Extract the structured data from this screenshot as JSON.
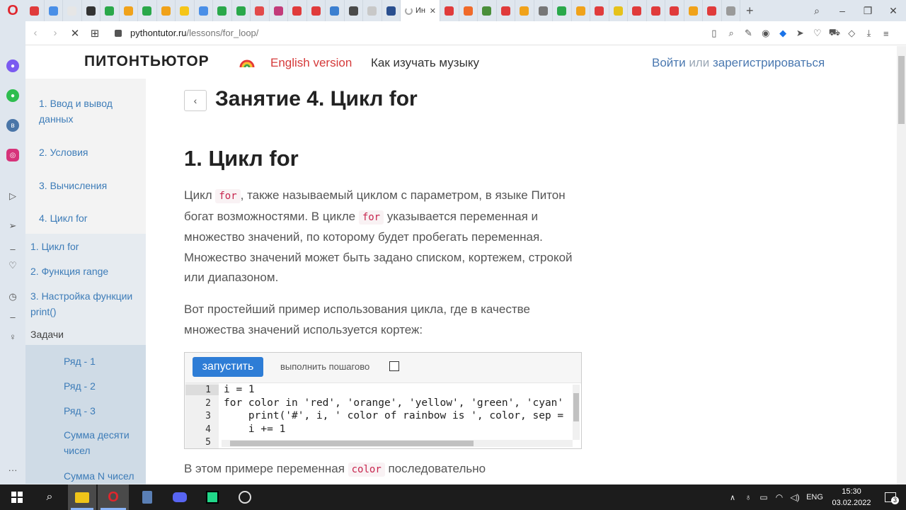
{
  "browser": {
    "active_tab_label": "Ин",
    "url_host": "pythontutor.ru",
    "url_path": "/lessons/for_loop/",
    "tab_favicon_colors": [
      "#e03b3b",
      "#4a8fe7",
      "#e6e6e6",
      "#333333",
      "#2aa84a",
      "#f0a21a",
      "#2aa84a",
      "#f0a21a",
      "#f5c518",
      "#4a8fe7",
      "#2aa84a",
      "#2aa84a",
      "#e24a4a",
      "#c23b7a",
      "#e03b3b",
      "#e03b3b",
      "#3b7fd0",
      "#4a4a4a",
      "#c8c8c8",
      "#2a4f8f",
      "#e03b3b",
      "#f06a2a",
      "#4a8f3a",
      "#e03b3b",
      "#f0a21a",
      "#777777",
      "#2aa84a",
      "#f0a21a",
      "#e03b3b",
      "#e6c21a",
      "#e03b3b",
      "#e03b3b",
      "#e03b3b",
      "#f0a21a",
      "#e03b3b",
      "#9a9a9a"
    ]
  },
  "site": {
    "logo": "ПИТОНТЬЮТОР",
    "english_link": "English version",
    "music_link": "Как изучать музыку",
    "login": "Войти",
    "or": "или",
    "register": "зарегистрироваться"
  },
  "nav": {
    "items": [
      {
        "label": "1. Ввод и вывод данных"
      },
      {
        "label": "2. Условия"
      },
      {
        "label": "3. Вычисления"
      },
      {
        "label": "4. Цикл for"
      }
    ],
    "sub": [
      {
        "label": "1. Цикл for"
      },
      {
        "label": "2. Функция range"
      },
      {
        "label": "3. Настройка функции print()"
      }
    ],
    "tasks_label": "Задачи",
    "tasks": [
      {
        "label": "Ряд - 1"
      },
      {
        "label": "Ряд - 2"
      },
      {
        "label": "Ряд - 3"
      },
      {
        "label": "Сумма десяти чисел"
      },
      {
        "label": "Сумма N чисел"
      }
    ]
  },
  "content": {
    "lesson_title": "Занятие 4. Цикл for",
    "section_title": "1. Цикл for",
    "p1_a": "Цикл ",
    "p1_code1": "for",
    "p1_b": ", также называемый циклом с параметром, в языке Питон богат возможностями. В цикле ",
    "p1_code2": "for",
    "p1_c": " указывается переменная и множество значений, по которому будет пробегать переменная. Множество значений может быть задано списком, кортежем, строкой или диапазоном.",
    "p2": "Вот простейший пример использования цикла, где в качестве множества значений используется кортеж:",
    "run_button": "запустить",
    "step_label": "выполнить пошагово",
    "code_lines": [
      {
        "n": "1",
        "text": "i = 1"
      },
      {
        "n": "2",
        "text": "for color in 'red', 'orange', 'yellow', 'green', 'cyan'"
      },
      {
        "n": "3",
        "text": "    print('#', i, ' color of rainbow is ', color, sep ="
      },
      {
        "n": "4",
        "text": "    i += 1"
      },
      {
        "n": "5",
        "text": ""
      }
    ],
    "p3_a": "В этом примере переменная ",
    "p3_code": "color",
    "p3_b": " последовательно"
  },
  "taskbar": {
    "time": "15:30",
    "date": "03.02.2022",
    "lang": "ENG",
    "notif_count": "3"
  }
}
